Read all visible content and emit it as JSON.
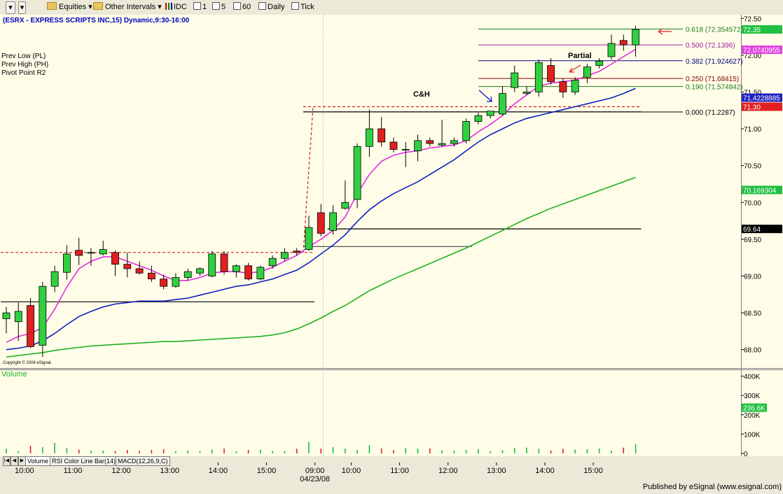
{
  "toolbar": {
    "equities": "Equities",
    "other_intervals": "Other Intervals",
    "intervals": [
      "IDC",
      "1",
      "5",
      "60",
      "Daily",
      "Tick"
    ]
  },
  "chart_title": "(ESRX - EXPRESS SCRIPTS INC,15) Dynamic,9:30-16:00",
  "legend": [
    "Prev Low (PL)",
    "Prev High (PH)",
    "Pivot Point R2"
  ],
  "copyright": "Copyright © 2006 eSignal.",
  "publisher": "Published by eSignal (www.esignal.com)",
  "annotations": {
    "cup_handle": "C&H",
    "partial": "Partial"
  },
  "volume_label": "Volume",
  "tabs": [
    "Volume",
    "RSI Color Line Bar(14)",
    "MACD(12,26,9,C)"
  ],
  "fib_levels": [
    {
      "ratio": "0.618",
      "label": "0.618 (72.354572)",
      "price": 72.3546,
      "color": "#1e7a1e"
    },
    {
      "ratio": "0.500",
      "label": "0.500 (72.1396)",
      "price": 72.1396,
      "color": "#a020a0"
    },
    {
      "ratio": "0.382",
      "label": "0.382 (71.924627)",
      "price": 71.9246,
      "color": "#000080"
    },
    {
      "ratio": "0.250",
      "label": "0.250 (71.68415)",
      "price": 71.6842,
      "color": "#8b0000"
    },
    {
      "ratio": "0.190",
      "label": "0.190 (71.574842)",
      "price": 71.5748,
      "color": "#1e7a1e"
    },
    {
      "ratio": "0.000",
      "label": "0.000 (71.2287)",
      "price": 71.2287,
      "color": "#000000"
    }
  ],
  "price_badges": [
    {
      "text": "72.35",
      "price": 72.35,
      "bg": "#20c040",
      "fg": "#ffffff"
    },
    {
      "text": "72.0740955",
      "price": 72.074,
      "bg": "#e040e0",
      "fg": "#ffffff"
    },
    {
      "text": "71.4228885",
      "price": 71.4229,
      "bg": "#2020c0",
      "fg": "#ffffff"
    },
    {
      "text": "71.30",
      "price": 71.3,
      "bg": "#e02020",
      "fg": "#ffffff"
    },
    {
      "text": "70.169304",
      "price": 70.1693,
      "bg": "#20c040",
      "fg": "#ffffff"
    },
    {
      "text": "69.64",
      "price": 69.64,
      "bg": "#000000",
      "fg": "#ffffff"
    }
  ],
  "volume_badge": {
    "text": "236.6K",
    "value": 236.6,
    "bg": "#20c040",
    "fg": "#ffffff"
  },
  "chart_data": {
    "type": "candlestick",
    "price_axis": {
      "min": 67.75,
      "max": 72.55,
      "ticks": [
        72.5,
        72.0,
        71.5,
        71.0,
        70.5,
        70.0,
        69.5,
        69.0,
        68.5,
        68.0
      ],
      "tick_labels": [
        "72.50",
        "72.00",
        "71.50",
        "71.00",
        "70.50",
        "70.00",
        "69.50",
        "69.00",
        "68.50",
        "68.00"
      ]
    },
    "volume_axis": {
      "min": 0,
      "max": 420,
      "ticks": [
        400,
        300,
        200,
        100,
        0
      ],
      "tick_labels": [
        "400K",
        "300K",
        "200K",
        "100K",
        "0"
      ]
    },
    "time_labels": [
      {
        "i": 1.5,
        "label": "10:00"
      },
      {
        "i": 5.5,
        "label": "11:00"
      },
      {
        "i": 9.5,
        "label": "12:00"
      },
      {
        "i": 13.5,
        "label": "13:00"
      },
      {
        "i": 17.5,
        "label": "14:00"
      },
      {
        "i": 21.5,
        "label": "15:00"
      },
      {
        "i": 25.5,
        "label": "09:00"
      },
      {
        "i": 28.5,
        "label": "10:00"
      },
      {
        "i": 32.5,
        "label": "11:00"
      },
      {
        "i": 36.5,
        "label": "12:00"
      },
      {
        "i": 40.5,
        "label": "13:00"
      },
      {
        "i": 44.5,
        "label": "14:00"
      },
      {
        "i": 48.5,
        "label": "15:00"
      }
    ],
    "date_label": "04/23/08",
    "candles": [
      {
        "o": 68.42,
        "h": 68.58,
        "l": 68.22,
        "c": 68.5
      },
      {
        "o": 68.38,
        "h": 68.64,
        "l": 68.12,
        "c": 68.52
      },
      {
        "o": 68.6,
        "h": 68.7,
        "l": 68.02,
        "c": 68.04
      },
      {
        "o": 68.06,
        "h": 68.92,
        "l": 67.9,
        "c": 68.86
      },
      {
        "o": 68.86,
        "h": 69.14,
        "l": 68.78,
        "c": 69.06
      },
      {
        "o": 69.05,
        "h": 69.42,
        "l": 68.95,
        "c": 69.3
      },
      {
        "o": 69.35,
        "h": 69.52,
        "l": 69.15,
        "c": 69.28
      },
      {
        "o": 69.31,
        "h": 69.38,
        "l": 69.14,
        "c": 69.32
      },
      {
        "o": 69.3,
        "h": 69.48,
        "l": 69.28,
        "c": 69.36
      },
      {
        "o": 69.32,
        "h": 69.35,
        "l": 69.0,
        "c": 69.16
      },
      {
        "o": 69.16,
        "h": 69.32,
        "l": 68.98,
        "c": 69.1
      },
      {
        "o": 69.1,
        "h": 69.2,
        "l": 69.02,
        "c": 69.04
      },
      {
        "o": 69.04,
        "h": 69.14,
        "l": 68.92,
        "c": 68.96
      },
      {
        "o": 68.96,
        "h": 69.02,
        "l": 68.82,
        "c": 68.86
      },
      {
        "o": 68.86,
        "h": 69.04,
        "l": 68.84,
        "c": 68.98
      },
      {
        "o": 68.98,
        "h": 69.1,
        "l": 68.94,
        "c": 69.06
      },
      {
        "o": 69.04,
        "h": 69.12,
        "l": 69.0,
        "c": 69.1
      },
      {
        "o": 69.0,
        "h": 69.34,
        "l": 68.98,
        "c": 69.3
      },
      {
        "o": 69.3,
        "h": 69.34,
        "l": 69.02,
        "c": 69.06
      },
      {
        "o": 69.06,
        "h": 69.16,
        "l": 68.98,
        "c": 69.14
      },
      {
        "o": 69.14,
        "h": 69.18,
        "l": 68.94,
        "c": 68.96
      },
      {
        "o": 68.96,
        "h": 69.14,
        "l": 68.94,
        "c": 69.12
      },
      {
        "o": 69.14,
        "h": 69.28,
        "l": 69.1,
        "c": 69.24
      },
      {
        "o": 69.24,
        "h": 69.38,
        "l": 69.2,
        "c": 69.32
      },
      {
        "o": 69.34,
        "h": 69.38,
        "l": 69.28,
        "c": 69.32
      },
      {
        "o": 69.36,
        "h": 69.82,
        "l": 69.34,
        "c": 69.66
      },
      {
        "o": 69.86,
        "h": 69.98,
        "l": 69.54,
        "c": 69.58
      },
      {
        "o": 69.62,
        "h": 69.96,
        "l": 69.56,
        "c": 69.86
      },
      {
        "o": 69.92,
        "h": 70.3,
        "l": 69.9,
        "c": 70.0
      },
      {
        "o": 70.04,
        "h": 70.8,
        "l": 69.92,
        "c": 70.76
      },
      {
        "o": 70.76,
        "h": 71.26,
        "l": 70.62,
        "c": 71.0
      },
      {
        "o": 71.0,
        "h": 71.16,
        "l": 70.76,
        "c": 70.82
      },
      {
        "o": 70.82,
        "h": 70.88,
        "l": 70.68,
        "c": 70.72
      },
      {
        "o": 70.72,
        "h": 70.82,
        "l": 70.48,
        "c": 70.72
      },
      {
        "o": 70.7,
        "h": 70.92,
        "l": 70.56,
        "c": 70.84
      },
      {
        "o": 70.84,
        "h": 70.88,
        "l": 70.76,
        "c": 70.8
      },
      {
        "o": 70.78,
        "h": 71.12,
        "l": 70.76,
        "c": 70.8
      },
      {
        "o": 70.8,
        "h": 70.88,
        "l": 70.76,
        "c": 70.84
      },
      {
        "o": 70.84,
        "h": 71.14,
        "l": 70.8,
        "c": 71.1
      },
      {
        "o": 71.1,
        "h": 71.22,
        "l": 71.06,
        "c": 71.18
      },
      {
        "o": 71.18,
        "h": 71.24,
        "l": 71.14,
        "c": 71.24
      },
      {
        "o": 71.2,
        "h": 71.58,
        "l": 71.18,
        "c": 71.48
      },
      {
        "o": 71.56,
        "h": 71.86,
        "l": 71.5,
        "c": 71.76
      },
      {
        "o": 71.48,
        "h": 71.58,
        "l": 71.46,
        "c": 71.5
      },
      {
        "o": 71.5,
        "h": 71.94,
        "l": 71.44,
        "c": 71.9
      },
      {
        "o": 71.86,
        "h": 71.96,
        "l": 71.6,
        "c": 71.64
      },
      {
        "o": 71.64,
        "h": 71.68,
        "l": 71.42,
        "c": 71.5
      },
      {
        "o": 71.5,
        "h": 71.7,
        "l": 71.46,
        "c": 71.66
      },
      {
        "o": 71.7,
        "h": 71.88,
        "l": 71.62,
        "c": 71.84
      },
      {
        "o": 71.86,
        "h": 71.96,
        "l": 71.82,
        "c": 71.92
      },
      {
        "o": 71.98,
        "h": 72.28,
        "l": 71.94,
        "c": 72.16
      },
      {
        "o": 72.2,
        "h": 72.28,
        "l": 72.06,
        "c": 72.14
      },
      {
        "o": 72.14,
        "h": 72.4,
        "l": 71.98,
        "c": 72.35
      }
    ],
    "volume": [
      25,
      12,
      40,
      32,
      55,
      28,
      20,
      14,
      15,
      12,
      18,
      13,
      18,
      22,
      12,
      16,
      12,
      20,
      25,
      12,
      18,
      20,
      12,
      12,
      24,
      60,
      25,
      32,
      25,
      18,
      42,
      26,
      18,
      28,
      25,
      26,
      17,
      14,
      18,
      23,
      12,
      17,
      28,
      30,
      24,
      15,
      24,
      20,
      22,
      25,
      15,
      30,
      49
    ],
    "ma_fast": [
      68.1,
      68.18,
      68.22,
      68.3,
      68.55,
      68.85,
      69.1,
      69.2,
      69.26,
      69.26,
      69.2,
      69.14,
      69.08,
      69.0,
      68.94,
      68.94,
      68.98,
      69.04,
      69.06,
      69.06,
      69.04,
      69.06,
      69.12,
      69.2,
      69.28,
      69.4,
      69.5,
      69.62,
      69.8,
      70.12,
      70.38,
      70.56,
      70.64,
      70.68,
      70.7,
      70.74,
      70.76,
      70.78,
      70.84,
      70.96,
      71.06,
      71.18,
      71.34,
      71.46,
      71.58,
      71.62,
      71.64,
      71.66,
      71.72,
      71.78,
      71.88,
      71.98,
      72.08
    ],
    "ma_mid": [
      68.0,
      68.02,
      68.05,
      68.12,
      68.22,
      68.34,
      68.45,
      68.52,
      68.58,
      68.62,
      68.64,
      68.66,
      68.66,
      68.66,
      68.68,
      68.7,
      68.74,
      68.78,
      68.82,
      68.86,
      68.88,
      68.92,
      68.96,
      69.02,
      69.08,
      69.18,
      69.3,
      69.42,
      69.56,
      69.74,
      69.9,
      70.02,
      70.12,
      70.2,
      70.28,
      70.38,
      70.48,
      70.58,
      70.7,
      70.82,
      70.92,
      71.0,
      71.08,
      71.14,
      71.18,
      71.22,
      71.26,
      71.3,
      71.34,
      71.38,
      71.42,
      71.48,
      71.55
    ],
    "ma_slow": [
      67.9,
      67.92,
      67.94,
      67.96,
      67.99,
      68.01,
      68.03,
      68.05,
      68.06,
      68.07,
      68.08,
      68.09,
      68.1,
      68.11,
      68.11,
      68.12,
      68.13,
      68.14,
      68.15,
      68.16,
      68.17,
      68.18,
      68.2,
      68.23,
      68.28,
      68.35,
      68.43,
      68.52,
      68.6,
      68.7,
      68.8,
      68.88,
      68.96,
      69.03,
      69.1,
      69.17,
      69.24,
      69.31,
      69.38,
      69.46,
      69.54,
      69.62,
      69.7,
      69.78,
      69.85,
      69.92,
      69.98,
      70.04,
      70.1,
      70.16,
      70.22,
      70.28,
      70.34
    ],
    "horizontal_lines": [
      {
        "name": "prev-low-line",
        "price": 68.65,
        "from": 0,
        "to": 25,
        "color": "#000000",
        "dash": false
      },
      {
        "name": "prev-high-line",
        "price": 69.32,
        "from": 0,
        "to": 25,
        "color": "#d02020",
        "dash": true
      },
      {
        "name": "pivot-r2-line",
        "price": 71.3,
        "from": 25,
        "to": 52,
        "color": "#d02020",
        "dash": true
      },
      {
        "name": "support-line",
        "price": 69.64,
        "from": 27,
        "to": 52,
        "color": "#000000",
        "dash": false
      },
      {
        "name": "lower-support-line",
        "price": 69.4,
        "from": 25,
        "to": 38,
        "color": "#555555",
        "dash": false
      },
      {
        "name": "cup-handle-line",
        "price": 71.23,
        "from": 25,
        "to": 52,
        "color": "#000000",
        "dash": false
      }
    ]
  }
}
